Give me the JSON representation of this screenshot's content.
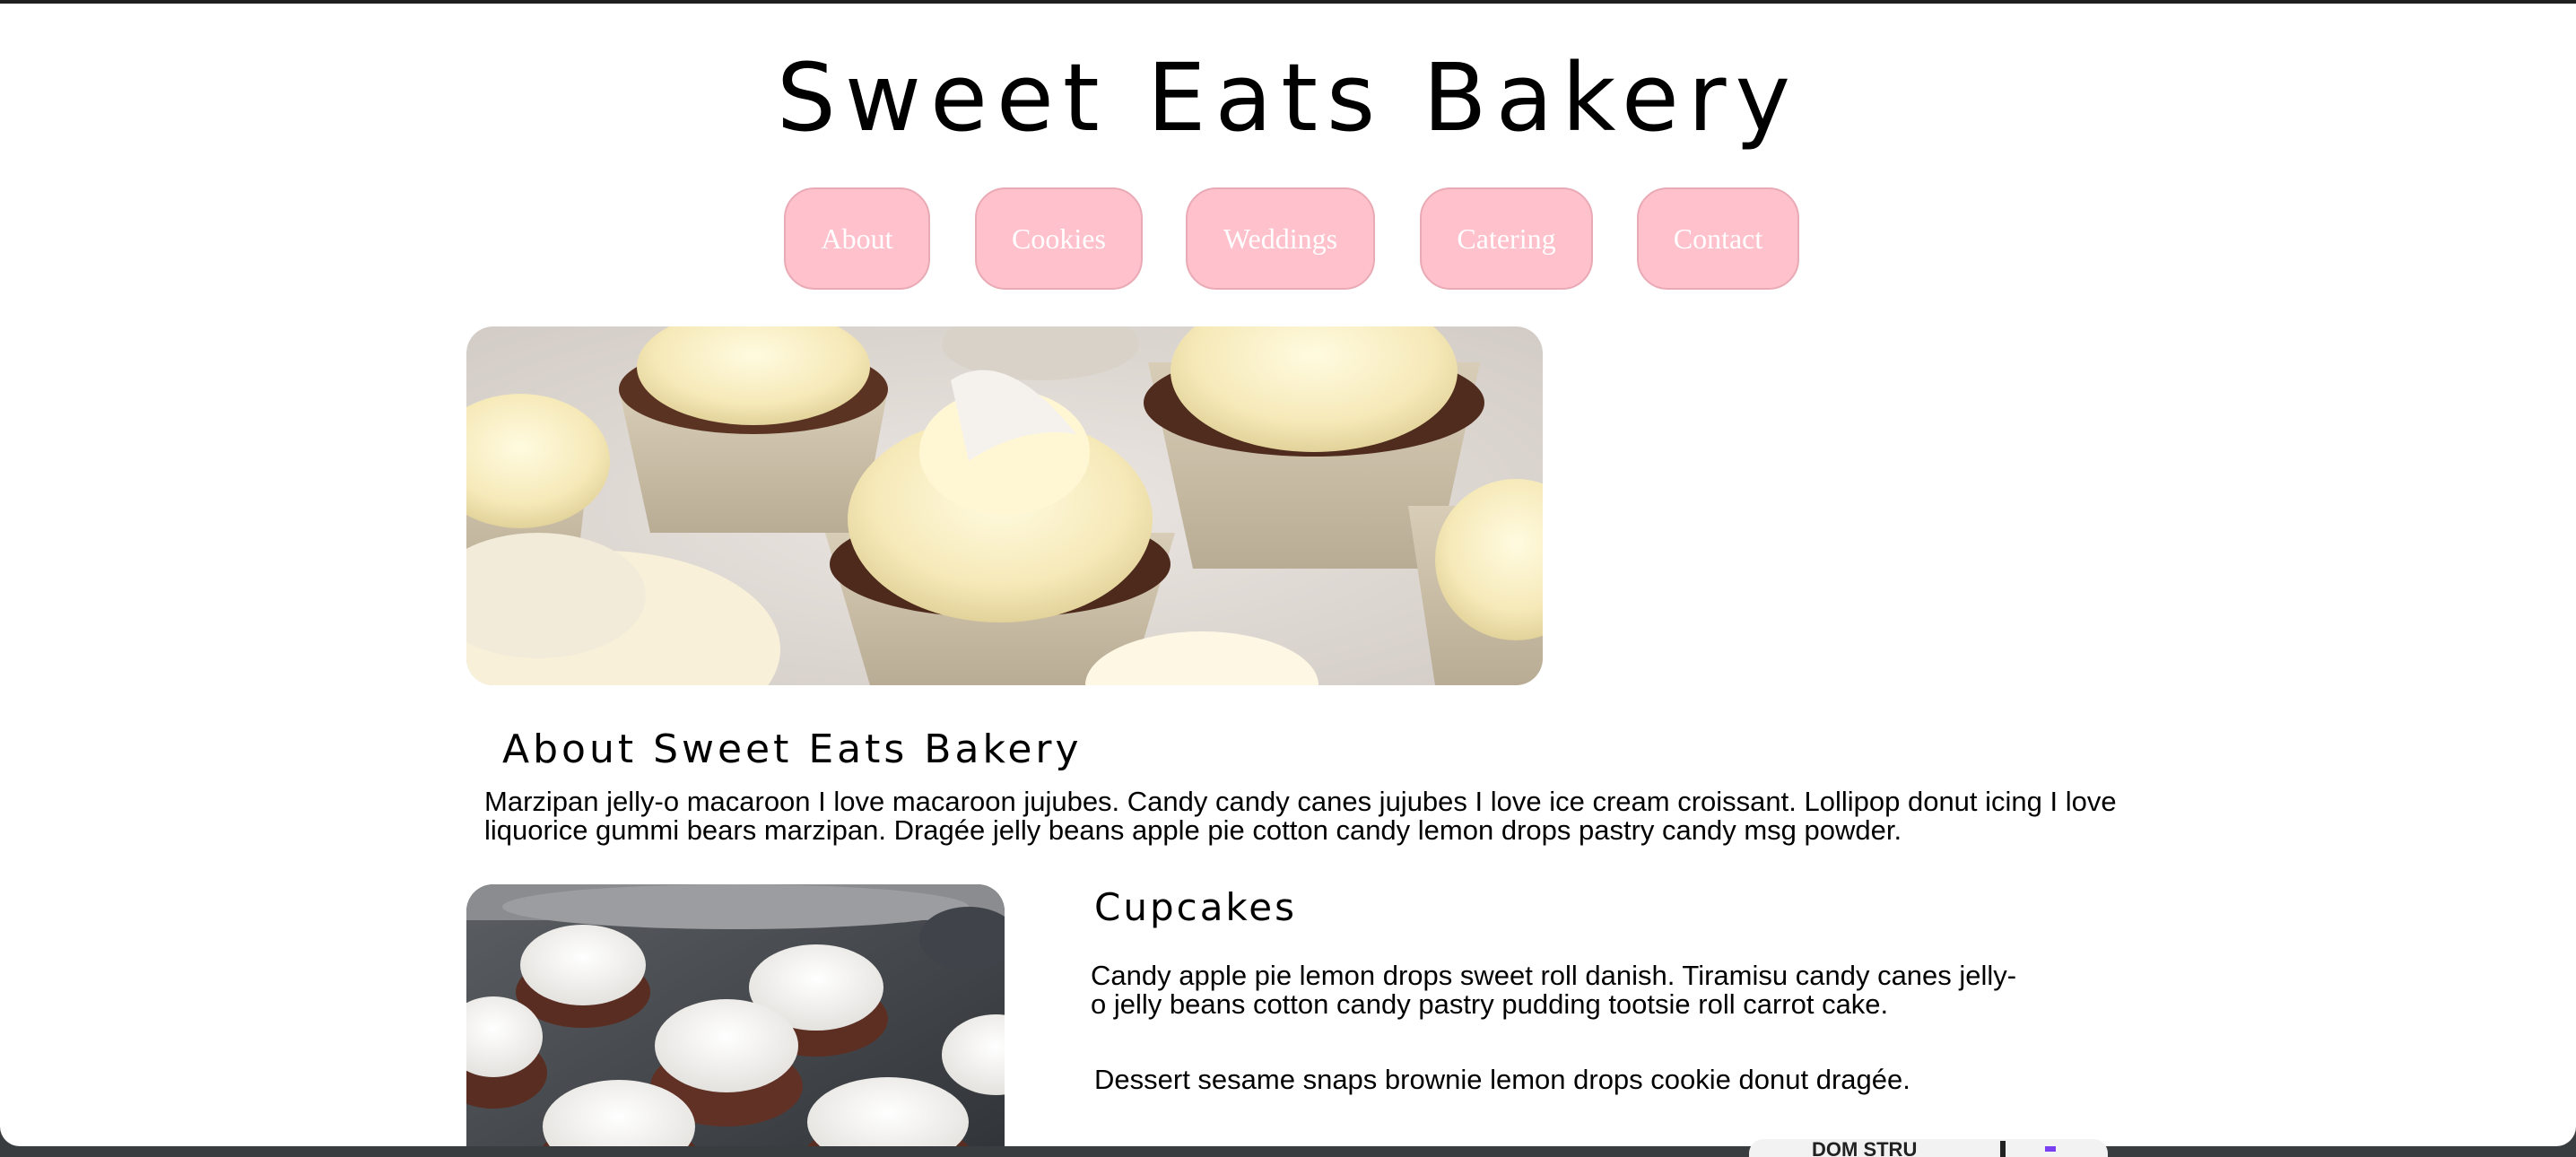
{
  "site": {
    "title": "Sweet Eats Bakery"
  },
  "nav": {
    "items": [
      {
        "label": "About"
      },
      {
        "label": "Cookies"
      },
      {
        "label": "Weddings"
      },
      {
        "label": "Catering"
      },
      {
        "label": "Contact"
      }
    ]
  },
  "about": {
    "heading": "About Sweet Eats Bakery",
    "text": "Marzipan jelly-o macaroon I love macaroon jujubes. Candy candy canes jujubes I love ice cream croissant. Lollipop donut icing I love liquorice gummi bears marzipan. Dragée jelly beans apple pie cotton candy lemon drops pastry candy msg powder."
  },
  "cupcakes": {
    "heading": "Cupcakes",
    "paragraph1": "Candy apple pie lemon drops sweet roll danish. Tiramisu candy canes jelly-o jelly beans cotton candy pastry pudding tootsie roll carrot cake.",
    "paragraph2": "Dessert sesame snaps brownie lemon drops cookie donut dragée."
  },
  "devtools": {
    "label": "DOM STRU"
  },
  "colors": {
    "nav_button_bg": "#ffc1cc",
    "nav_button_text": "#ffffff",
    "page_bg": "#ffffff"
  }
}
